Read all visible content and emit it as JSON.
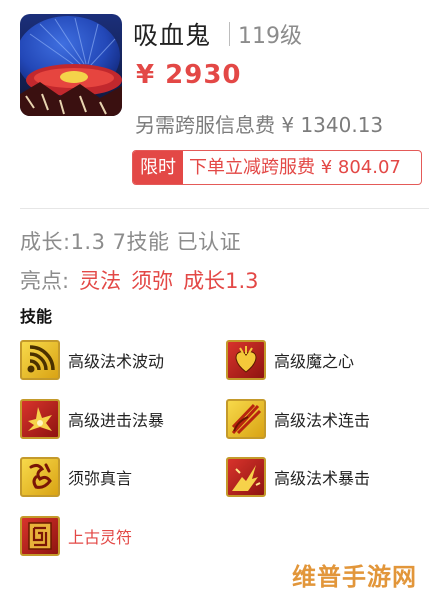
{
  "listing": {
    "pet_name": "吸血鬼",
    "level": "119级",
    "price": "¥ 2930",
    "extra_fee": "另需跨服信息费 ¥ 1340.13",
    "promo_tag": "限时",
    "promo_text": "下单立减跨服费 ¥ 804.07"
  },
  "details": {
    "info_line": "成长:1.3 7技能 已认证",
    "highlights_label": "亮点:",
    "highlights": [
      "灵法",
      "须弥",
      "成长1.3"
    ],
    "skills_title": "技能"
  },
  "skills": [
    {
      "name": "高级法术波动",
      "icon": "wave-icon",
      "color": "#222222"
    },
    {
      "name": "高级魔之心",
      "icon": "heart-icon",
      "color": "#222222"
    },
    {
      "name": "高级进击法暴",
      "icon": "burst-icon",
      "color": "#222222"
    },
    {
      "name": "高级法术连击",
      "icon": "combo-strike-icon",
      "color": "#222222"
    },
    {
      "name": "须弥真言",
      "icon": "rune-icon",
      "color": "#222222"
    },
    {
      "name": "高级法术暴击",
      "icon": "crit-icon",
      "color": "#222222"
    },
    {
      "name": "上古灵符",
      "icon": "talisman-icon",
      "color": "#e34846"
    }
  ],
  "watermark": "维普手游网",
  "colors": {
    "accent": "#e34846",
    "muted": "#8c8c8c",
    "icon_gold": "#c49a2b"
  }
}
